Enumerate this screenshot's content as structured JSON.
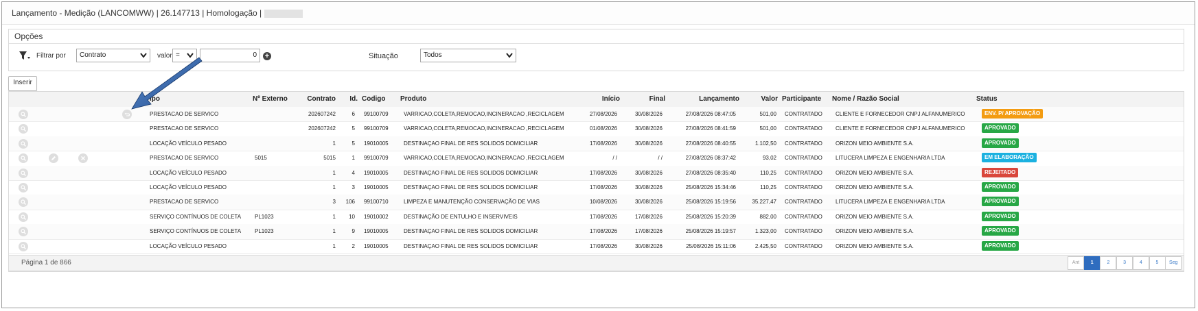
{
  "window": {
    "title": "Lançamento - Medição (LANCOMWW) | 26.147713 | Homologação |"
  },
  "options": {
    "title": "Opções",
    "filter_by_label": "Filtrar por",
    "filter_field": "Contrato",
    "value_label": "valor",
    "operator": "=",
    "value": "0",
    "situation_label": "Situação",
    "situation_value": "Todos"
  },
  "toolbar": {
    "insert_label": "Inserir"
  },
  "table": {
    "columns": {
      "tipo": "Tipo",
      "externo": "Nº Externo",
      "contrato": "Contrato",
      "id": "Id.",
      "codigo": "Codigo",
      "produto": "Produto",
      "inicio": "Início",
      "final": "Final",
      "lancamento": "Lançamento",
      "valor": "Valor",
      "participante": "Participante",
      "nome": "Nome / Razão Social",
      "status": "Status"
    },
    "rows": [
      {
        "tipo": "PRESTACAO DE SERVICO",
        "externo": "",
        "contrato": "202607242",
        "id": "6",
        "codigo": "99100709",
        "produto": "VARRICAO,COLETA,REMOCAO,INCINERACAO ,RECICLAGEM",
        "inicio": "27/08/2026",
        "final": "30/08/2026",
        "lancamento": "27/08/2026 08:47:05",
        "valor": "501,00",
        "participante": "CONTRATADO",
        "nome": "CLIENTE E FORNECEDOR CNPJ ALFANUMERICO",
        "status": "ENV. P/ APROVAÇÃO",
        "status_color": "#f39c12",
        "actions": [
          "search",
          "undo"
        ]
      },
      {
        "tipo": "PRESTACAO DE SERVICO",
        "externo": "",
        "contrato": "202607242",
        "id": "5",
        "codigo": "99100709",
        "produto": "VARRICAO,COLETA,REMOCAO,INCINERACAO ,RECICLAGEM",
        "inicio": "01/08/2026",
        "final": "30/08/2026",
        "lancamento": "27/08/2026 08:41:59",
        "valor": "501,00",
        "participante": "CONTRATADO",
        "nome": "CLIENTE E FORNECEDOR CNPJ ALFANUMERICO",
        "status": "APROVADO",
        "status_color": "#27a745",
        "actions": [
          "search"
        ]
      },
      {
        "tipo": "LOCAÇÃO VEÍCULO PESADO",
        "externo": "",
        "contrato": "1",
        "id": "5",
        "codigo": "19010005",
        "produto": "DESTINAÇAO FINAL DE RES SOLIDOS DOMICILIAR",
        "inicio": "17/08/2026",
        "final": "30/08/2026",
        "lancamento": "27/08/2026 08:40:55",
        "valor": "1.102,50",
        "participante": "CONTRATADO",
        "nome": "ORIZON MEIO AMBIENTE S.A.",
        "status": "APROVADO",
        "status_color": "#27a745",
        "actions": [
          "search"
        ]
      },
      {
        "tipo": "PRESTACAO DE SERVICO",
        "externo": "5015",
        "contrato": "5015",
        "id": "1",
        "codigo": "99100709",
        "produto": "VARRICAO,COLETA,REMOCAO,INCINERACAO ,RECICLAGEM",
        "inicio": "/ /",
        "final": "/ /",
        "lancamento": "27/08/2026 08:37:42",
        "valor": "93,02",
        "participante": "CONTRATADO",
        "nome": "LITUCERA LIMPEZA E ENGENHARIA LTDA",
        "status": "EM ELABORAÇÃO",
        "status_color": "#1bb1e0",
        "actions": [
          "search",
          "edit",
          "delete"
        ]
      },
      {
        "tipo": "LOCAÇÃO VEÍCULO PESADO",
        "externo": "",
        "contrato": "1",
        "id": "4",
        "codigo": "19010005",
        "produto": "DESTINAÇAO FINAL DE RES SOLIDOS DOMICILIAR",
        "inicio": "17/08/2026",
        "final": "30/08/2026",
        "lancamento": "27/08/2026 08:35:40",
        "valor": "110,25",
        "participante": "CONTRATADO",
        "nome": "ORIZON MEIO AMBIENTE S.A.",
        "status": "REJEITADO",
        "status_color": "#d9463b",
        "actions": [
          "search"
        ]
      },
      {
        "tipo": "LOCAÇÃO VEÍCULO PESADO",
        "externo": "",
        "contrato": "1",
        "id": "3",
        "codigo": "19010005",
        "produto": "DESTINAÇAO FINAL DE RES SOLIDOS DOMICILIAR",
        "inicio": "17/08/2026",
        "final": "30/08/2026",
        "lancamento": "25/08/2026 15:34:46",
        "valor": "110,25",
        "participante": "CONTRATADO",
        "nome": "ORIZON MEIO AMBIENTE S.A.",
        "status": "APROVADO",
        "status_color": "#27a745",
        "actions": [
          "search"
        ]
      },
      {
        "tipo": "PRESTACAO DE SERVICO",
        "externo": "",
        "contrato": "3",
        "id": "106",
        "codigo": "99100710",
        "produto": "LIMPEZA E MANUTENÇÃO CONSERVAÇÃO DE VIAS",
        "inicio": "10/08/2026",
        "final": "30/08/2026",
        "lancamento": "25/08/2026 15:19:56",
        "valor": "35.227,47",
        "participante": "CONTRATADO",
        "nome": "LITUCERA LIMPEZA E ENGENHARIA LTDA",
        "status": "APROVADO",
        "status_color": "#27a745",
        "actions": [
          "search"
        ]
      },
      {
        "tipo": "SERVIÇO CONTÍNUOS DE COLETA",
        "externo": "PL1023",
        "contrato": "1",
        "id": "10",
        "codigo": "19010002",
        "produto": "DESTINAÇÃO DE ENTULHO E INSERVIVEIS",
        "inicio": "17/08/2026",
        "final": "17/08/2026",
        "lancamento": "25/08/2026 15:20:39",
        "valor": "882,00",
        "participante": "CONTRATADO",
        "nome": "ORIZON MEIO AMBIENTE S.A.",
        "status": "APROVADO",
        "status_color": "#27a745",
        "actions": [
          "search"
        ]
      },
      {
        "tipo": "SERVIÇO CONTÍNUOS DE COLETA",
        "externo": "PL1023",
        "contrato": "1",
        "id": "9",
        "codigo": "19010005",
        "produto": "DESTINAÇAO FINAL DE RES SOLIDOS DOMICILIAR",
        "inicio": "17/08/2026",
        "final": "17/08/2026",
        "lancamento": "25/08/2026 15:19:57",
        "valor": "1.323,00",
        "participante": "CONTRATADO",
        "nome": "ORIZON MEIO AMBIENTE S.A.",
        "status": "APROVADO",
        "status_color": "#27a745",
        "actions": [
          "search"
        ]
      },
      {
        "tipo": "LOCAÇÃO VEÍCULO PESADO",
        "externo": "",
        "contrato": "1",
        "id": "2",
        "codigo": "19010005",
        "produto": "DESTINAÇAO FINAL DE RES SOLIDOS DOMICILIAR",
        "inicio": "17/08/2026",
        "final": "30/08/2026",
        "lancamento": "25/08/2026 15:11:06",
        "valor": "2.425,50",
        "participante": "CONTRATADO",
        "nome": "ORIZON MEIO AMBIENTE S.A.",
        "status": "APROVADO",
        "status_color": "#27a745",
        "actions": [
          "search"
        ]
      }
    ]
  },
  "pagination": {
    "info": "Página 1 de 866",
    "prev": "Ant",
    "pages": [
      "1",
      "2",
      "3",
      "4",
      "5"
    ],
    "next": "Seg",
    "current": "1"
  },
  "colors": {
    "accent": "#2f6dbf",
    "arrow": "#1e4a8c"
  }
}
